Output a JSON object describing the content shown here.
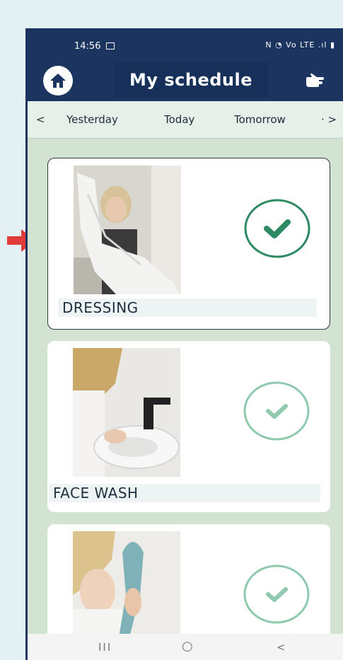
{
  "status": {
    "time": "14:56",
    "icons": "N  ◔  Vo LTE  .ıl  ▮"
  },
  "header": {
    "title": "My schedule"
  },
  "daynav": {
    "prev": "<",
    "yesterday": "Yesterday",
    "today": "Today",
    "tomorrow": "Tomorrow",
    "next": "· >"
  },
  "cards": [
    {
      "label": "DRESSING",
      "checked": true
    },
    {
      "label": "FACE WASH",
      "checked": false
    },
    {
      "label": "",
      "checked": false
    }
  ],
  "navbar": {
    "recents": "III",
    "home": "○",
    "back": "<"
  },
  "colors": {
    "header": "#1b3560",
    "background": "#d2e3d2",
    "check_active": "#2e8a62",
    "check_inactive": "#8fc9ae",
    "arrow": "#e23b3b"
  }
}
